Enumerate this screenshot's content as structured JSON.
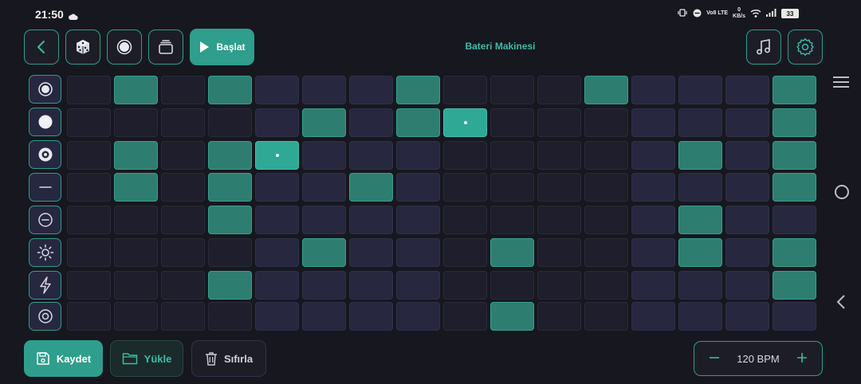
{
  "status_bar": {
    "time": "21:50",
    "net_label": "Vo8 LTE",
    "net_speed_value": "0",
    "net_speed_unit": "KB/s",
    "battery": "33"
  },
  "header": {
    "start_label": "Başlat",
    "title": "Bateri Makinesi"
  },
  "colors": {
    "accent": "#2f9e8c",
    "active_cell": "#2e7d71",
    "current_cell": "#2fa896",
    "background": "#17171f"
  },
  "tracks": [
    {
      "icon": "target-ring-icon"
    },
    {
      "icon": "filled-circle-icon"
    },
    {
      "icon": "disc-icon"
    },
    {
      "icon": "minus-line-icon"
    },
    {
      "icon": "minus-circle-icon"
    },
    {
      "icon": "sun-icon"
    },
    {
      "icon": "lightning-icon"
    },
    {
      "icon": "double-circle-icon"
    }
  ],
  "sequencer": {
    "steps": 16,
    "pattern": [
      [
        0,
        1,
        0,
        1,
        0,
        0,
        0,
        1,
        0,
        0,
        0,
        1,
        0,
        0,
        0,
        1
      ],
      [
        0,
        0,
        0,
        0,
        0,
        1,
        0,
        1,
        1,
        0,
        0,
        0,
        0,
        0,
        0,
        1
      ],
      [
        0,
        1,
        0,
        1,
        1,
        0,
        0,
        0,
        0,
        0,
        0,
        0,
        0,
        1,
        0,
        1
      ],
      [
        0,
        1,
        0,
        1,
        0,
        0,
        1,
        0,
        0,
        0,
        0,
        0,
        0,
        0,
        0,
        1
      ],
      [
        0,
        0,
        0,
        1,
        0,
        0,
        0,
        0,
        0,
        0,
        0,
        0,
        0,
        1,
        0,
        0
      ],
      [
        0,
        0,
        0,
        0,
        0,
        1,
        0,
        0,
        0,
        1,
        0,
        0,
        0,
        1,
        0,
        1
      ],
      [
        0,
        0,
        0,
        1,
        0,
        0,
        0,
        0,
        0,
        0,
        0,
        0,
        0,
        0,
        0,
        1
      ],
      [
        0,
        0,
        0,
        0,
        0,
        0,
        0,
        0,
        0,
        1,
        0,
        0,
        0,
        0,
        0,
        0
      ]
    ],
    "current_cells": [
      [
        1,
        8
      ],
      [
        2,
        4
      ]
    ]
  },
  "footer": {
    "save_label": "Kaydet",
    "load_label": "Yükle",
    "reset_label": "Sıfırla",
    "bpm_label": "120 BPM"
  }
}
